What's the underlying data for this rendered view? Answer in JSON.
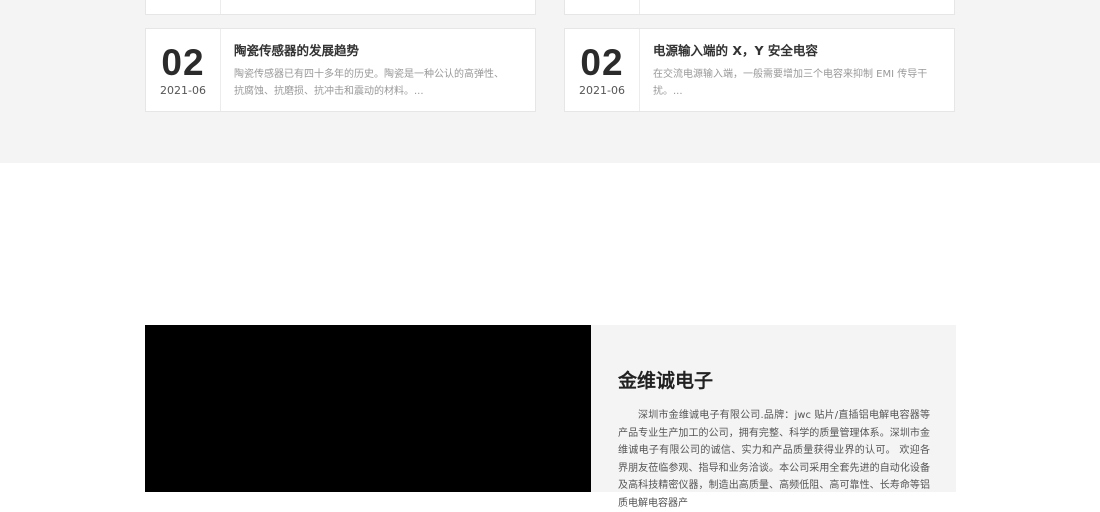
{
  "news": {
    "items": [
      {
        "day": "02",
        "year_month": "2021-06",
        "title": "陶瓷传感器的发展趋势",
        "excerpt": "陶瓷传感器已有四十多年的历史。陶瓷是一种公认的高弹性、抗腐蚀、抗磨损、抗冲击和震动的材料。..."
      },
      {
        "day": "02",
        "year_month": "2021-06",
        "title": "电源输入端的 X，Y 安全电容",
        "excerpt": "在交流电源输入端，一般需要增加三个电容来抑制 EMI 传导干扰。..."
      }
    ]
  },
  "about": {
    "title": "金维诚电子",
    "description": "深圳市金维诚电子有限公司.品牌：jwc 贴片/直插铝电解电容器等产品专业生产加工的公司，拥有完整、科学的质量管理体系。深圳市金维诚电子有限公司的诚信、实力和产品质量获得业界的认可。 欢迎各界朋友莅临参观、指导和业务洽谈。本公司采用全套先进的自动化设备及高科技精密仪器，制造出高质量、高频低阻、高可靠性、长寿命等铝质电解电容器产"
  }
}
